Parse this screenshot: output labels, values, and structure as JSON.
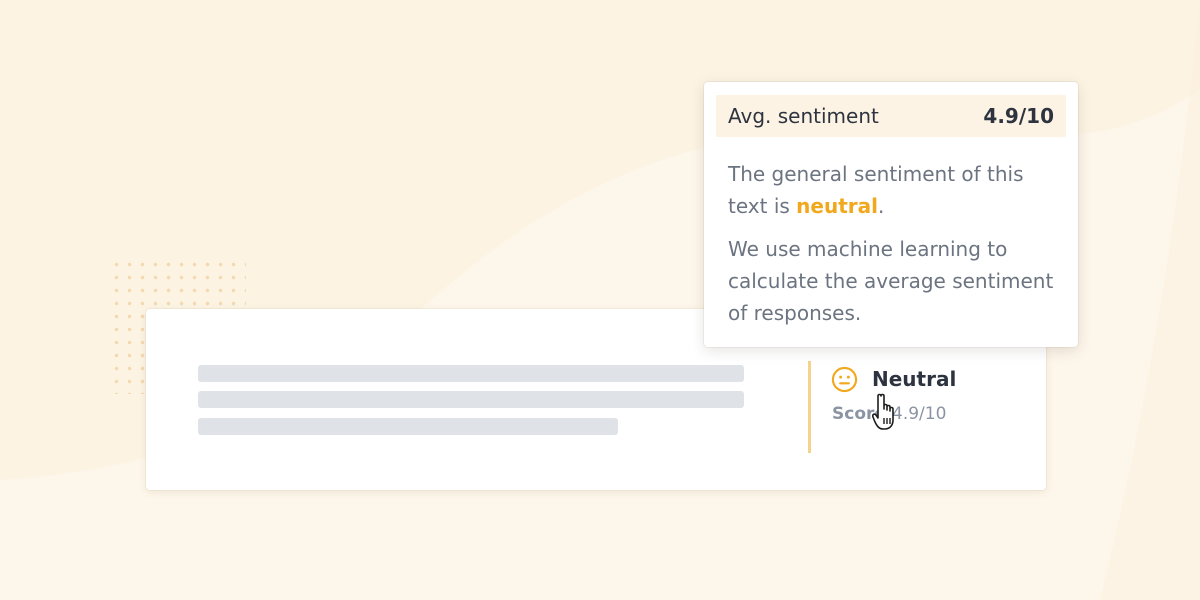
{
  "card": {
    "sentiment_label": "Neutral",
    "score_label": "Score",
    "score_value": "4.9/10"
  },
  "tooltip": {
    "title": "Avg. sentiment",
    "value": "4.9/10",
    "para1_prefix": "The general sentiment of this text is ",
    "para1_highlight": "neutral",
    "para1_suffix": ".",
    "para2": "We use machine learning to calculate the average sentiment of responses."
  },
  "icons": {
    "sentiment": "neutral-face-icon",
    "cursor": "hand-pointer-icon"
  },
  "colors": {
    "accent": "#f2a81d",
    "divider": "#f3d38e",
    "background": "#fdf6ea"
  }
}
